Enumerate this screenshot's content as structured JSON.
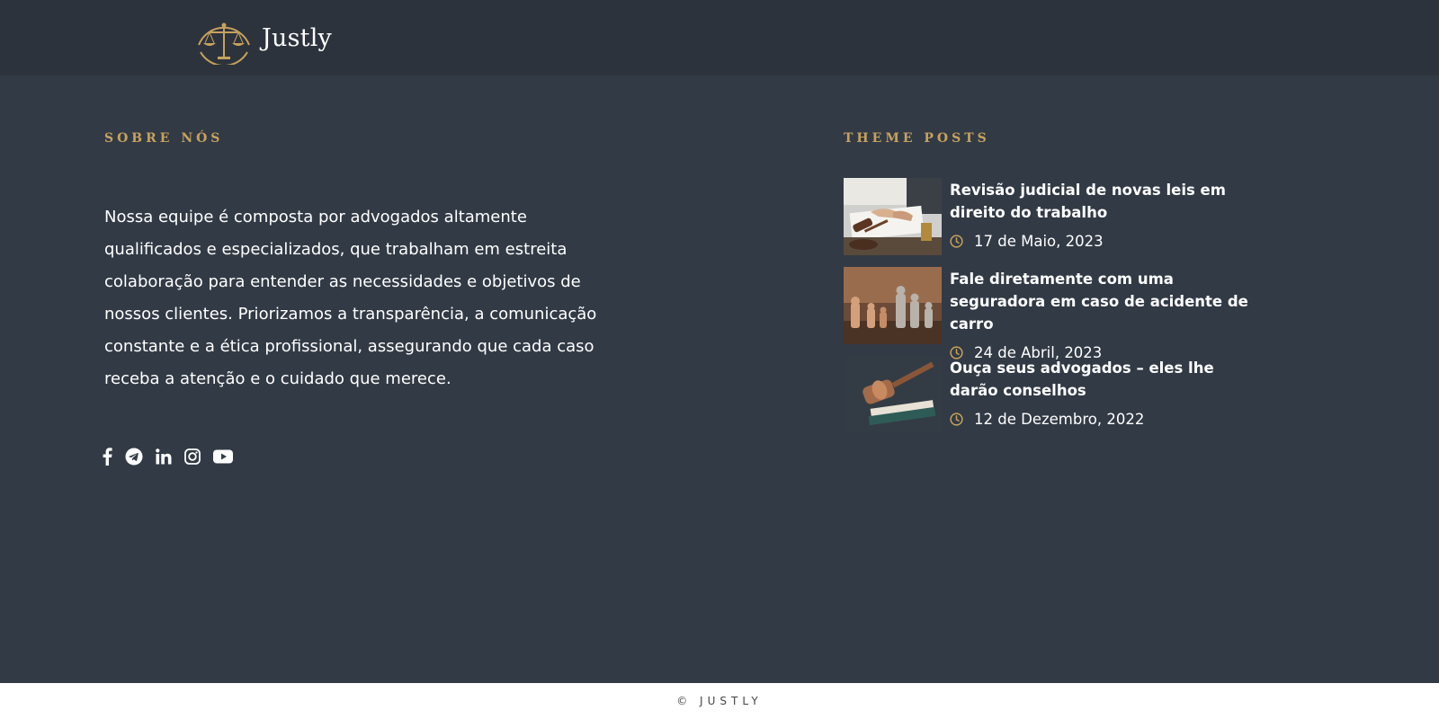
{
  "brand": {
    "name": "Justly",
    "icon": "scales-of-justice-icon",
    "accent": "#c7a25c"
  },
  "about": {
    "heading": "SOBRE NÓS",
    "text": "Nossa equipe é composta por advogados altamente qualificados e especializados, que trabalham em estreita colaboração para entender as necessidades e objetivos de nossos clientes. Priorizamos a transparência, a comunicação constante e a ética profissional, assegurando que cada caso receba a atenção e o cuidado que merece.",
    "social": [
      "facebook-icon",
      "telegram-icon",
      "linkedin-icon",
      "instagram-icon",
      "youtube-icon"
    ]
  },
  "posts": {
    "heading": "THEME POSTS",
    "items": [
      {
        "title": "Revisão judicial de novas leis em direito do trabalho",
        "date": "17 de Maio, 2023",
        "image": "gavel-and-contract"
      },
      {
        "title": "Fale diretamente com uma seguradora em caso de acidente de carro",
        "date": "24 de Abril, 2023",
        "image": "chess-pieces"
      },
      {
        "title": "Ouça seus advogados – eles lhe darão conselhos",
        "date": "12 de Dezembro, 2022",
        "image": "gavel-on-books"
      }
    ]
  },
  "footer": {
    "copyright": "© JUSTLY"
  },
  "colors": {
    "background": "#323a45",
    "topbar": "#2d333c",
    "accent": "#c7a25c"
  }
}
